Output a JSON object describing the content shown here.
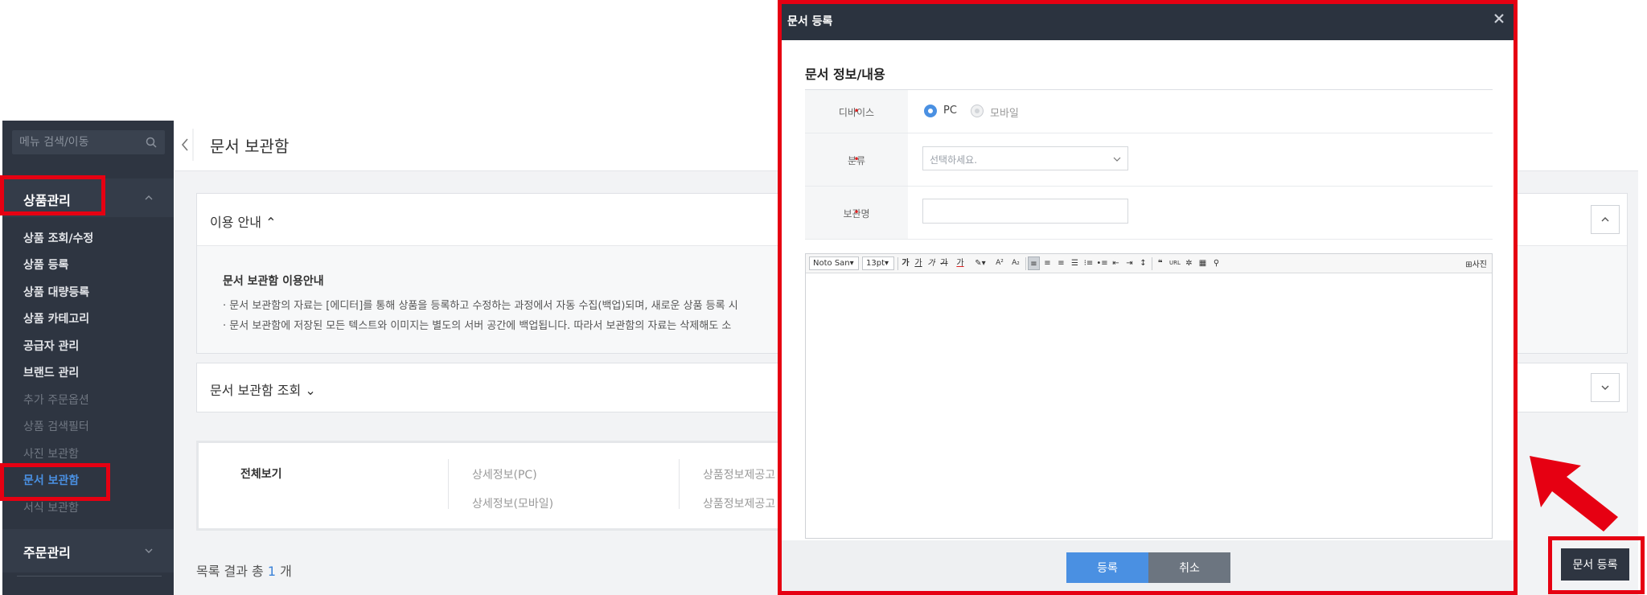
{
  "sidebar": {
    "search_placeholder": "메뉴 검색/이동",
    "section_product": "상품관리",
    "items": [
      "상품 조회/수정",
      "상품 등록",
      "상품 대량등록",
      "상품 카테고리",
      "공급자 관리",
      "브랜드 관리",
      "추가 주문옵션",
      "상품 검색필터",
      "사진 보관함",
      "문서 보관함",
      "서식 보관함"
    ],
    "section_order": "주문관리"
  },
  "main": {
    "page_title": "문서 보관함",
    "guide_title": "이용 안내",
    "guide_heading": "문서 보관함 이용안내",
    "guide_line_1": "· 문서 보관함의 자료는 [에디터]를 통해 상품을 등록하고 수정하는 과정에서 자동 수집(백업)되며, 새로운 상품 등록 시",
    "guide_line_2": "· 문서 보관함에 저장된 모든 텍스트와 이미지는 별도의 서버 공간에 백업됩니다. 따라서 보관함의 자료는 삭제해도 소",
    "search_title": "문서 보관함 조회",
    "categories": {
      "all": "전체보기",
      "detail_pc": "상세정보(PC)",
      "detail_mobile": "상세정보(모바일)",
      "notice_1": "상품정보제공고",
      "notice_2": "상품정보제공고"
    },
    "result_prefix": "목록 결과 총",
    "result_count": "1",
    "result_suffix": "개",
    "register_button": "문서 등록"
  },
  "modal": {
    "title": "문서 등록",
    "section_title": "문서 정보/내용",
    "device_label": "디바이스",
    "device_options": [
      "PC",
      "모바일"
    ],
    "device_selected": "PC",
    "category_label": "분류",
    "category_placeholder": "선택하세요.",
    "name_label": "보관명",
    "editor": {
      "font": "Noto San",
      "size": "13pt",
      "bold": "가",
      "underline": "가",
      "italic": "가",
      "strike": "가",
      "color": "가",
      "photo": "사진"
    },
    "submit_label": "등록",
    "cancel_label": "취소"
  },
  "colors": {
    "highlight": "#e60012",
    "sidebar_bg": "#2e3541",
    "accent": "#4a90e2"
  }
}
